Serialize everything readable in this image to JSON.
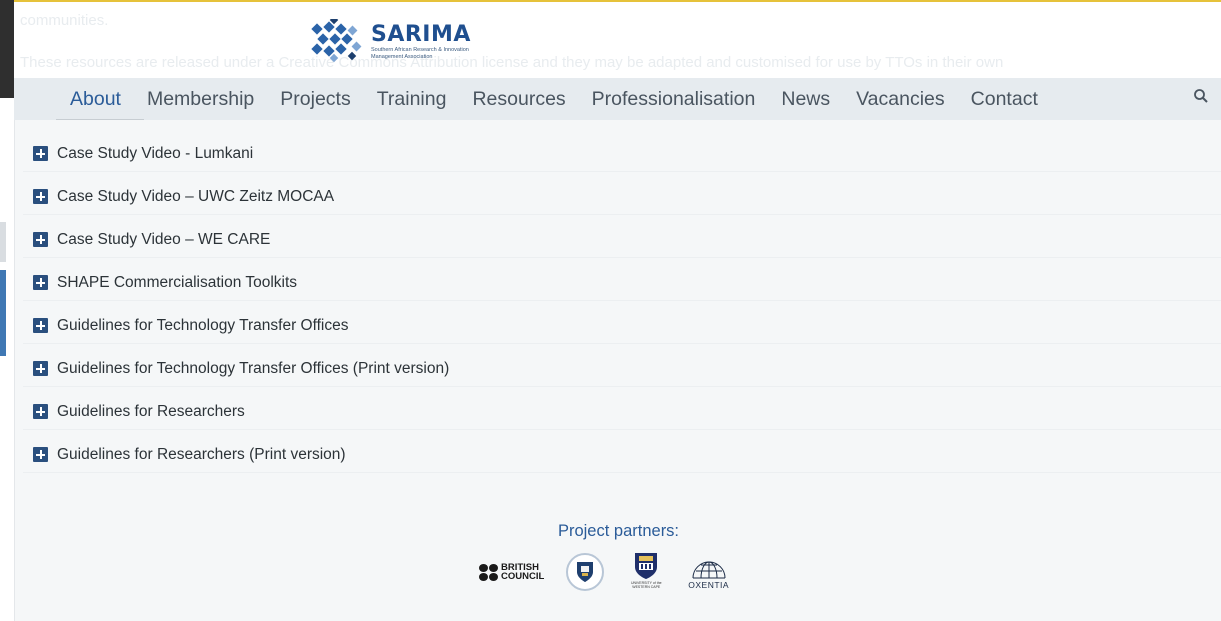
{
  "background_text": {
    "line1": "communities.",
    "line2": "These resources are released under a Creative Commons Attribution license and they may be adapted and customised for use by TTOs in their own"
  },
  "logo": {
    "title": "SARIMA",
    "subtitle": "Southern African Research & Innovation Management Association"
  },
  "nav": {
    "items": [
      {
        "label": "About",
        "active": true
      },
      {
        "label": "Membership"
      },
      {
        "label": "Projects"
      },
      {
        "label": "Training"
      },
      {
        "label": "Resources"
      },
      {
        "label": "Professionalisation"
      },
      {
        "label": "News"
      },
      {
        "label": "Vacancies"
      },
      {
        "label": "Contact"
      }
    ],
    "search_icon": "search-icon"
  },
  "accordion": [
    {
      "label": "Case Study Video - Lumkani"
    },
    {
      "label": "Case Study Video – UWC Zeitz MOCAA"
    },
    {
      "label": "Case Study Video – WE CARE"
    },
    {
      "label": "SHAPE Commercialisation Toolkits"
    },
    {
      "label": "Guidelines for Technology Transfer Offices"
    },
    {
      "label": "Guidelines for Technology Transfer Offices (Print version)"
    },
    {
      "label": "Guidelines for Researchers"
    },
    {
      "label": "Guidelines for Researchers (Print version)"
    }
  ],
  "partners": {
    "title": "Project partners:",
    "british_council": {
      "line1": "BRITISH",
      "line2": "COUNCIL"
    },
    "uwc_text": "UNIVERSITY of the WESTERN CAPE",
    "oxentia": "OXENTIA"
  },
  "colors": {
    "accent": "#2b5c99",
    "nav_bg": "#e6ebef",
    "plus_icon": "#2a4f7e",
    "top_line": "#e6c23a"
  }
}
